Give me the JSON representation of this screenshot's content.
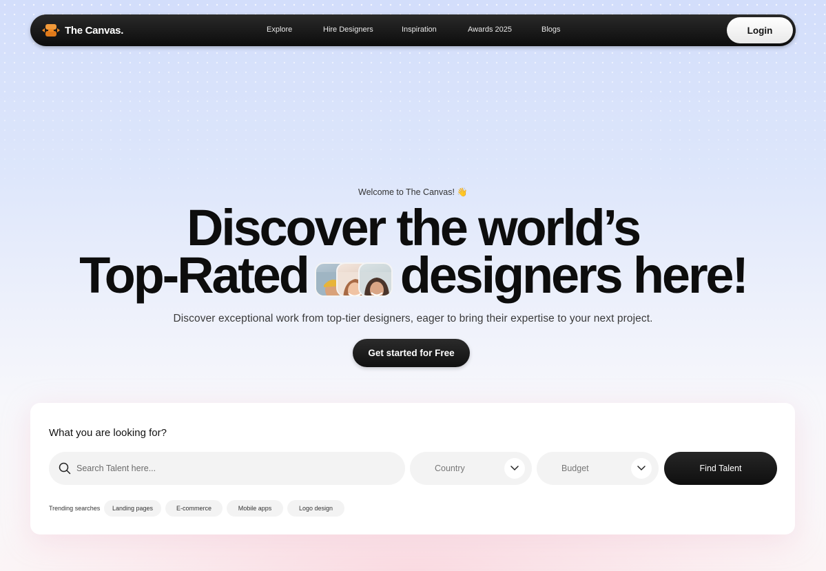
{
  "nav": {
    "brand": "The Canvas.",
    "links": [
      "Explore",
      "Hire Designers",
      "Inspiration",
      "Awards 2025",
      "Blogs"
    ],
    "login_label": "Login"
  },
  "hero": {
    "welcome": "Welcome to The Canvas! 👋",
    "headline_line1": "Discover the world’s",
    "headline_line2_start": "Top-Rated",
    "headline_line2_end": "designers here!",
    "subtext": "Discover exceptional work from top-tier designers, eager to bring their expertise to your next project.",
    "cta_label": "Get started for Free"
  },
  "search": {
    "title": "What you are looking for?",
    "placeholder": "Search Talent here...",
    "country_label": "Country",
    "budget_label": "Budget",
    "find_label": "Find Talent",
    "trending_label": "Trending searches",
    "trending": [
      "Landing pages",
      "E-commerce",
      "Mobile apps",
      "Logo design"
    ]
  },
  "colors": {
    "brand_orange": "#f08a24",
    "nav_bg": "#111111",
    "accent_dark": "#141414"
  }
}
